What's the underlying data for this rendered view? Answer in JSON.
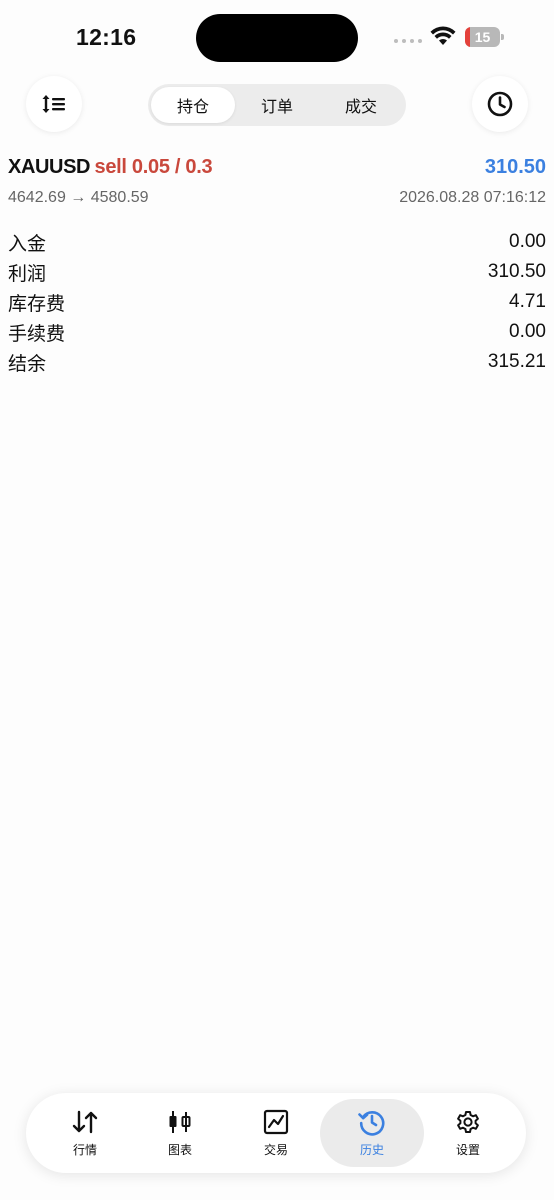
{
  "status_bar": {
    "time": "12:16",
    "battery_level": "15",
    "battery_fraction": 0.15
  },
  "toolbar": {
    "sort_icon": "sort-icon",
    "history_icon": "clock-icon",
    "segments": [
      {
        "label": "持仓",
        "active": true
      },
      {
        "label": "订单",
        "active": false
      },
      {
        "label": "成交",
        "active": false
      }
    ]
  },
  "position": {
    "symbol": "XAUUSD",
    "side_volume": "sell 0.05 / 0.3",
    "profit": "310.50",
    "price_change": "4642.69 → 4580.59",
    "timestamp": "2026.08.28 07:16:12"
  },
  "details": [
    {
      "label": "入金",
      "value": "0.00"
    },
    {
      "label": "利润",
      "value": "310.50"
    },
    {
      "label": "库存费",
      "value": "4.71"
    },
    {
      "label": "手续费",
      "value": "0.00"
    },
    {
      "label": "结余",
      "value": "315.21"
    }
  ],
  "tabs": [
    {
      "label": "行情",
      "icon": "quotes-icon"
    },
    {
      "label": "图表",
      "icon": "chart-icon"
    },
    {
      "label": "交易",
      "icon": "trade-icon"
    },
    {
      "label": "历史",
      "icon": "history-icon",
      "active": true
    },
    {
      "label": "设置",
      "icon": "settings-icon"
    }
  ],
  "colors": {
    "accent_blue": "#3b80e0",
    "sell_red": "#c9483c",
    "battery_red": "#e4413b"
  }
}
